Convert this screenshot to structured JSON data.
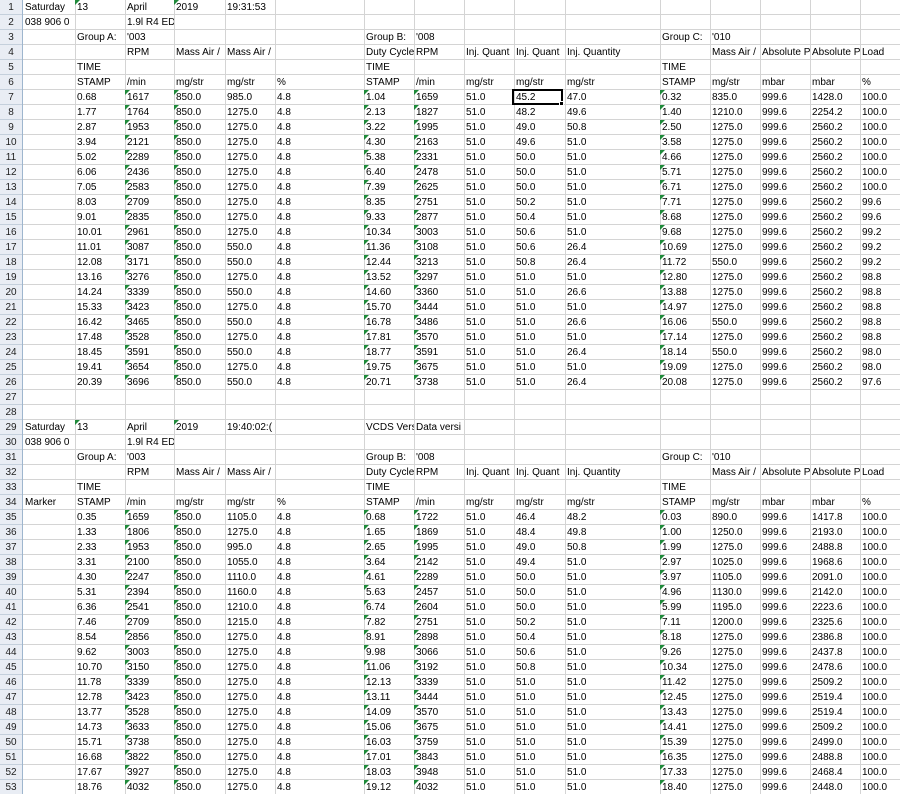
{
  "rows": [
    {
      "n": "1",
      "cells": {
        "A": "Saturday",
        "B": "13",
        "C": "April",
        "D": "2019",
        "E": "19:31:53"
      }
    },
    {
      "n": "2",
      "cells": {
        "A": "038 906 0",
        "C": "1.9l R4 ED"
      }
    },
    {
      "n": "3",
      "cells": {
        "B": "Group A:",
        "C": "'003",
        "F": "Group B:",
        "G": "'008",
        "K": "Group C:",
        "L": "'010"
      }
    },
    {
      "n": "4",
      "cells": {
        "C": "RPM",
        "D": "Mass Air /",
        "E": "Mass Air /",
        "F": "Duty Cycle",
        "G2": "RPM",
        "H": "Inj. Quant",
        "I": "Inj. Quant",
        "J": "Inj. Quantity",
        "L": "Mass Air /",
        "M": "Absolute P",
        "N": "Absolute P",
        "O": "Load"
      }
    },
    {
      "n": "5",
      "cells": {
        "B": "TIME",
        "F2": "TIME",
        "K": "TIME"
      }
    },
    {
      "n": "6",
      "cells": {
        "B": "STAMP",
        "C": "/min",
        "D": "mg/str",
        "E": "mg/str",
        "Ep": "%",
        "F2": "STAMP",
        "G2": "/min",
        "H": "mg/str",
        "I": "mg/str",
        "J": "mg/str",
        "K": "STAMP",
        "L": "mg/str",
        "M": "mbar",
        "N": "mbar",
        "O": "%"
      }
    },
    {
      "n": "7",
      "cells": {
        "B": "0.68",
        "C": "1617",
        "D": "850.0",
        "E": "985.0",
        "Ep": "4.8",
        "F2": "1.04",
        "G2": "1659",
        "H": "51.0",
        "I": "45.2",
        "J": "47.0",
        "K": "0.32",
        "L": "835.0",
        "M": "999.6",
        "N": "1428.0",
        "O": "100.0"
      }
    },
    {
      "n": "8",
      "cells": {
        "B": "1.77",
        "C": "1764",
        "D": "850.0",
        "E": "1275.0",
        "Ep": "4.8",
        "F2": "2.13",
        "G2": "1827",
        "H": "51.0",
        "I": "48.2",
        "J": "49.6",
        "K": "1.40",
        "L": "1210.0",
        "M": "999.6",
        "N": "2254.2",
        "O": "100.0"
      }
    },
    {
      "n": "9",
      "cells": {
        "B": "2.87",
        "C": "1953",
        "D": "850.0",
        "E": "1275.0",
        "Ep": "4.8",
        "F2": "3.22",
        "G2": "1995",
        "H": "51.0",
        "I": "49.0",
        "J": "50.8",
        "K": "2.50",
        "L": "1275.0",
        "M": "999.6",
        "N": "2560.2",
        "O": "100.0"
      }
    },
    {
      "n": "10",
      "cells": {
        "B": "3.94",
        "C": "2121",
        "D": "850.0",
        "E": "1275.0",
        "Ep": "4.8",
        "F2": "4.30",
        "G2": "2163",
        "H": "51.0",
        "I": "49.6",
        "J": "51.0",
        "K": "3.58",
        "L": "1275.0",
        "M": "999.6",
        "N": "2560.2",
        "O": "100.0"
      }
    },
    {
      "n": "11",
      "cells": {
        "B": "5.02",
        "C": "2289",
        "D": "850.0",
        "E": "1275.0",
        "Ep": "4.8",
        "F2": "5.38",
        "G2": "2331",
        "H": "51.0",
        "I": "50.0",
        "J": "51.0",
        "K": "4.66",
        "L": "1275.0",
        "M": "999.6",
        "N": "2560.2",
        "O": "100.0"
      }
    },
    {
      "n": "12",
      "cells": {
        "B": "6.06",
        "C": "2436",
        "D": "850.0",
        "E": "1275.0",
        "Ep": "4.8",
        "F2": "6.40",
        "G2": "2478",
        "H": "51.0",
        "I": "50.0",
        "J": "51.0",
        "K": "5.71",
        "L": "1275.0",
        "M": "999.6",
        "N": "2560.2",
        "O": "100.0"
      }
    },
    {
      "n": "13",
      "cells": {
        "B": "7.05",
        "C": "2583",
        "D": "850.0",
        "E": "1275.0",
        "Ep": "4.8",
        "F2": "7.39",
        "G2": "2625",
        "H": "51.0",
        "I": "50.0",
        "J": "51.0",
        "K": "6.71",
        "L": "1275.0",
        "M": "999.6",
        "N": "2560.2",
        "O": "100.0"
      }
    },
    {
      "n": "14",
      "cells": {
        "B": "8.03",
        "C": "2709",
        "D": "850.0",
        "E": "1275.0",
        "Ep": "4.8",
        "F2": "8.35",
        "G2": "2751",
        "H": "51.0",
        "I": "50.2",
        "J": "51.0",
        "K": "7.71",
        "L": "1275.0",
        "M": "999.6",
        "N": "2560.2",
        "O": "99.6"
      }
    },
    {
      "n": "15",
      "cells": {
        "B": "9.01",
        "C": "2835",
        "D": "850.0",
        "E": "1275.0",
        "Ep": "4.8",
        "F2": "9.33",
        "G2": "2877",
        "H": "51.0",
        "I": "50.4",
        "J": "51.0",
        "K": "8.68",
        "L": "1275.0",
        "M": "999.6",
        "N": "2560.2",
        "O": "99.6"
      }
    },
    {
      "n": "16",
      "cells": {
        "B": "10.01",
        "C": "2961",
        "D": "850.0",
        "E": "1275.0",
        "Ep": "4.8",
        "F2": "10.34",
        "G2": "3003",
        "H": "51.0",
        "I": "50.6",
        "J": "51.0",
        "K": "9.68",
        "L": "1275.0",
        "M": "999.6",
        "N": "2560.2",
        "O": "99.2"
      }
    },
    {
      "n": "17",
      "cells": {
        "B": "11.01",
        "C": "3087",
        "D": "850.0",
        "E": "550.0",
        "Ep": "4.8",
        "F2": "11.36",
        "G2": "3108",
        "H": "51.0",
        "I": "50.6",
        "J": "26.4",
        "K": "10.69",
        "L": "1275.0",
        "M": "999.6",
        "N": "2560.2",
        "O": "99.2"
      }
    },
    {
      "n": "18",
      "cells": {
        "B": "12.08",
        "C": "3171",
        "D": "850.0",
        "E": "550.0",
        "Ep": "4.8",
        "F2": "12.44",
        "G2": "3213",
        "H": "51.0",
        "I": "50.8",
        "J": "26.4",
        "K": "11.72",
        "L": "550.0",
        "M": "999.6",
        "N": "2560.2",
        "O": "99.2"
      }
    },
    {
      "n": "19",
      "cells": {
        "B": "13.16",
        "C": "3276",
        "D": "850.0",
        "E": "1275.0",
        "Ep": "4.8",
        "F2": "13.52",
        "G2": "3297",
        "H": "51.0",
        "I": "51.0",
        "J": "51.0",
        "K": "12.80",
        "L": "1275.0",
        "M": "999.6",
        "N": "2560.2",
        "O": "98.8"
      }
    },
    {
      "n": "20",
      "cells": {
        "B": "14.24",
        "C": "3339",
        "D": "850.0",
        "E": "550.0",
        "Ep": "4.8",
        "F2": "14.60",
        "G2": "3360",
        "H": "51.0",
        "I": "51.0",
        "J": "26.6",
        "K": "13.88",
        "L": "1275.0",
        "M": "999.6",
        "N": "2560.2",
        "O": "98.8"
      }
    },
    {
      "n": "21",
      "cells": {
        "B": "15.33",
        "C": "3423",
        "D": "850.0",
        "E": "1275.0",
        "Ep": "4.8",
        "F2": "15.70",
        "G2": "3444",
        "H": "51.0",
        "I": "51.0",
        "J": "51.0",
        "K": "14.97",
        "L": "1275.0",
        "M": "999.6",
        "N": "2560.2",
        "O": "98.8"
      }
    },
    {
      "n": "22",
      "cells": {
        "B": "16.42",
        "C": "3465",
        "D": "850.0",
        "E": "550.0",
        "Ep": "4.8",
        "F2": "16.78",
        "G2": "3486",
        "H": "51.0",
        "I": "51.0",
        "J": "26.6",
        "K": "16.06",
        "L": "550.0",
        "M": "999.6",
        "N": "2560.2",
        "O": "98.8"
      }
    },
    {
      "n": "23",
      "cells": {
        "B": "17.48",
        "C": "3528",
        "D": "850.0",
        "E": "1275.0",
        "Ep": "4.8",
        "F2": "17.81",
        "G2": "3570",
        "H": "51.0",
        "I": "51.0",
        "J": "51.0",
        "K": "17.14",
        "L": "1275.0",
        "M": "999.6",
        "N": "2560.2",
        "O": "98.8"
      }
    },
    {
      "n": "24",
      "cells": {
        "B": "18.45",
        "C": "3591",
        "D": "850.0",
        "E": "550.0",
        "Ep": "4.8",
        "F2": "18.77",
        "G2": "3591",
        "H": "51.0",
        "I": "51.0",
        "J": "26.4",
        "K": "18.14",
        "L": "550.0",
        "M": "999.6",
        "N": "2560.2",
        "O": "98.0"
      }
    },
    {
      "n": "25",
      "cells": {
        "B": "19.41",
        "C": "3654",
        "D": "850.0",
        "E": "1275.0",
        "Ep": "4.8",
        "F2": "19.75",
        "G2": "3675",
        "H": "51.0",
        "I": "51.0",
        "J": "51.0",
        "K": "19.09",
        "L": "1275.0",
        "M": "999.6",
        "N": "2560.2",
        "O": "98.0"
      }
    },
    {
      "n": "26",
      "cells": {
        "B": "20.39",
        "C": "3696",
        "D": "850.0",
        "E": "550.0",
        "Ep": "4.8",
        "F2": "20.71",
        "G2": "3738",
        "H": "51.0",
        "I": "51.0",
        "J": "26.4",
        "K": "20.08",
        "L": "1275.0",
        "M": "999.6",
        "N": "2560.2",
        "O": "97.6"
      }
    },
    {
      "n": "27",
      "cells": {}
    },
    {
      "n": "28",
      "cells": {}
    },
    {
      "n": "29",
      "cells": {
        "A": "Saturday",
        "B": "13",
        "C": "April",
        "D": "2019",
        "E": "19:40:02:(",
        "F": "VCDS Version: Rele",
        "G": "Data versi"
      }
    },
    {
      "n": "30",
      "cells": {
        "A": "038 906 0",
        "C": "1.9l R4 ED"
      }
    },
    {
      "n": "31",
      "cells": {
        "B": "Group A:",
        "C": "'003",
        "F": "Group B:",
        "G": "'008",
        "K": "Group C:",
        "L": "'010"
      }
    },
    {
      "n": "32",
      "cells": {
        "C": "RPM",
        "D": "Mass Air /",
        "E": "Mass Air /",
        "F": "Duty Cycle",
        "G2": "RPM",
        "H": "Inj. Quant",
        "I": "Inj. Quant",
        "J": "Inj. Quantity",
        "L": "Mass Air /",
        "M": "Absolute P",
        "N": "Absolute P",
        "O": "Load"
      }
    },
    {
      "n": "33",
      "cells": {
        "B": "TIME",
        "F2": "TIME",
        "K": "TIME"
      }
    },
    {
      "n": "34",
      "cells": {
        "A": "Marker",
        "B": "STAMP",
        "C": "/min",
        "D": "mg/str",
        "E": "mg/str",
        "Ep": "%",
        "F2": "STAMP",
        "G2": "/min",
        "H": "mg/str",
        "I": "mg/str",
        "J": "mg/str",
        "K": "STAMP",
        "L": "mg/str",
        "M": "mbar",
        "N": "mbar",
        "O": "%"
      }
    },
    {
      "n": "35",
      "cells": {
        "B": "0.35",
        "C": "1659",
        "D": "850.0",
        "E": "1105.0",
        "Ep": "4.8",
        "F2": "0.68",
        "G2": "1722",
        "H": "51.0",
        "I": "46.4",
        "J": "48.2",
        "K": "0.03",
        "L": "890.0",
        "M": "999.6",
        "N": "1417.8",
        "O": "100.0"
      }
    },
    {
      "n": "36",
      "cells": {
        "B": "1.33",
        "C": "1806",
        "D": "850.0",
        "E": "1275.0",
        "Ep": "4.8",
        "F2": "1.65",
        "G2": "1869",
        "H": "51.0",
        "I": "48.4",
        "J": "49.8",
        "K": "1.00",
        "L": "1250.0",
        "M": "999.6",
        "N": "2193.0",
        "O": "100.0"
      }
    },
    {
      "n": "37",
      "cells": {
        "B": "2.33",
        "C": "1953",
        "D": "850.0",
        "E": "995.0",
        "Ep": "4.8",
        "F2": "2.65",
        "G2": "1995",
        "H": "51.0",
        "I": "49.0",
        "J": "50.8",
        "K": "1.99",
        "L": "1275.0",
        "M": "999.6",
        "N": "2488.8",
        "O": "100.0"
      }
    },
    {
      "n": "38",
      "cells": {
        "B": "3.31",
        "C": "2100",
        "D": "850.0",
        "E": "1055.0",
        "Ep": "4.8",
        "F2": "3.64",
        "G2": "2142",
        "H": "51.0",
        "I": "49.4",
        "J": "51.0",
        "K": "2.97",
        "L": "1025.0",
        "M": "999.6",
        "N": "1968.6",
        "O": "100.0"
      }
    },
    {
      "n": "39",
      "cells": {
        "B": "4.30",
        "C": "2247",
        "D": "850.0",
        "E": "1110.0",
        "Ep": "4.8",
        "F2": "4.61",
        "G2": "2289",
        "H": "51.0",
        "I": "50.0",
        "J": "51.0",
        "K": "3.97",
        "L": "1105.0",
        "M": "999.6",
        "N": "2091.0",
        "O": "100.0"
      }
    },
    {
      "n": "40",
      "cells": {
        "B": "5.31",
        "C": "2394",
        "D": "850.0",
        "E": "1160.0",
        "Ep": "4.8",
        "F2": "5.63",
        "G2": "2457",
        "H": "51.0",
        "I": "50.0",
        "J": "51.0",
        "K": "4.96",
        "L": "1130.0",
        "M": "999.6",
        "N": "2142.0",
        "O": "100.0"
      }
    },
    {
      "n": "41",
      "cells": {
        "B": "6.36",
        "C": "2541",
        "D": "850.0",
        "E": "1210.0",
        "Ep": "4.8",
        "F2": "6.74",
        "G2": "2604",
        "H": "51.0",
        "I": "50.0",
        "J": "51.0",
        "K": "5.99",
        "L": "1195.0",
        "M": "999.6",
        "N": "2223.6",
        "O": "100.0"
      }
    },
    {
      "n": "42",
      "cells": {
        "B": "7.46",
        "C": "2709",
        "D": "850.0",
        "E": "1215.0",
        "Ep": "4.8",
        "F2": "7.82",
        "G2": "2751",
        "H": "51.0",
        "I": "50.2",
        "J": "51.0",
        "K": "7.11",
        "L": "1200.0",
        "M": "999.6",
        "N": "2325.6",
        "O": "100.0"
      }
    },
    {
      "n": "43",
      "cells": {
        "B": "8.54",
        "C": "2856",
        "D": "850.0",
        "E": "1275.0",
        "Ep": "4.8",
        "F2": "8.91",
        "G2": "2898",
        "H": "51.0",
        "I": "50.4",
        "J": "51.0",
        "K": "8.18",
        "L": "1275.0",
        "M": "999.6",
        "N": "2386.8",
        "O": "100.0"
      }
    },
    {
      "n": "44",
      "cells": {
        "B": "9.62",
        "C": "3003",
        "D": "850.0",
        "E": "1275.0",
        "Ep": "4.8",
        "F2": "9.98",
        "G2": "3066",
        "H": "51.0",
        "I": "50.6",
        "J": "51.0",
        "K": "9.26",
        "L": "1275.0",
        "M": "999.6",
        "N": "2437.8",
        "O": "100.0"
      }
    },
    {
      "n": "45",
      "cells": {
        "B": "10.70",
        "C": "3150",
        "D": "850.0",
        "E": "1275.0",
        "Ep": "4.8",
        "F2": "11.06",
        "G2": "3192",
        "H": "51.0",
        "I": "50.8",
        "J": "51.0",
        "K": "10.34",
        "L": "1275.0",
        "M": "999.6",
        "N": "2478.6",
        "O": "100.0"
      }
    },
    {
      "n": "46",
      "cells": {
        "B": "11.78",
        "C": "3339",
        "D": "850.0",
        "E": "1275.0",
        "Ep": "4.8",
        "F2": "12.13",
        "G2": "3339",
        "H": "51.0",
        "I": "51.0",
        "J": "51.0",
        "K": "11.42",
        "L": "1275.0",
        "M": "999.6",
        "N": "2509.2",
        "O": "100.0"
      }
    },
    {
      "n": "47",
      "cells": {
        "B": "12.78",
        "C": "3423",
        "D": "850.0",
        "E": "1275.0",
        "Ep": "4.8",
        "F2": "13.11",
        "G2": "3444",
        "H": "51.0",
        "I": "51.0",
        "J": "51.0",
        "K": "12.45",
        "L": "1275.0",
        "M": "999.6",
        "N": "2519.4",
        "O": "100.0"
      }
    },
    {
      "n": "48",
      "cells": {
        "B": "13.77",
        "C": "3528",
        "D": "850.0",
        "E": "1275.0",
        "Ep": "4.8",
        "F2": "14.09",
        "G2": "3570",
        "H": "51.0",
        "I": "51.0",
        "J": "51.0",
        "K": "13.43",
        "L": "1275.0",
        "M": "999.6",
        "N": "2519.4",
        "O": "100.0"
      }
    },
    {
      "n": "49",
      "cells": {
        "B": "14.73",
        "C": "3633",
        "D": "850.0",
        "E": "1275.0",
        "Ep": "4.8",
        "F2": "15.06",
        "G2": "3675",
        "H": "51.0",
        "I": "51.0",
        "J": "51.0",
        "K": "14.41",
        "L": "1275.0",
        "M": "999.6",
        "N": "2509.2",
        "O": "100.0"
      }
    },
    {
      "n": "50",
      "cells": {
        "B": "15.71",
        "C": "3738",
        "D": "850.0",
        "E": "1275.0",
        "Ep": "4.8",
        "F2": "16.03",
        "G2": "3759",
        "H": "51.0",
        "I": "51.0",
        "J": "51.0",
        "K": "15.39",
        "L": "1275.0",
        "M": "999.6",
        "N": "2499.0",
        "O": "100.0"
      }
    },
    {
      "n": "51",
      "cells": {
        "B": "16.68",
        "C": "3822",
        "D": "850.0",
        "E": "1275.0",
        "Ep": "4.8",
        "F2": "17.01",
        "G2": "3843",
        "H": "51.0",
        "I": "51.0",
        "J": "51.0",
        "K": "16.35",
        "L": "1275.0",
        "M": "999.6",
        "N": "2488.8",
        "O": "100.0"
      }
    },
    {
      "n": "52",
      "cells": {
        "B": "17.67",
        "C": "3927",
        "D": "850.0",
        "E": "1275.0",
        "Ep": "4.8",
        "F2": "18.03",
        "G2": "3948",
        "H": "51.0",
        "I": "51.0",
        "J": "51.0",
        "K": "17.33",
        "L": "1275.0",
        "M": "999.6",
        "N": "2468.4",
        "O": "100.0"
      }
    },
    {
      "n": "53",
      "cells": {
        "B": "18.76",
        "C": "4032",
        "D": "850.0",
        "E": "1275.0",
        "Ep": "4.8",
        "F2": "19.12",
        "G2": "4032",
        "H": "51.0",
        "I": "51.0",
        "J": "51.0",
        "K": "18.40",
        "L": "1275.0",
        "M": "999.6",
        "N": "2448.0",
        "O": "100.0"
      }
    }
  ]
}
